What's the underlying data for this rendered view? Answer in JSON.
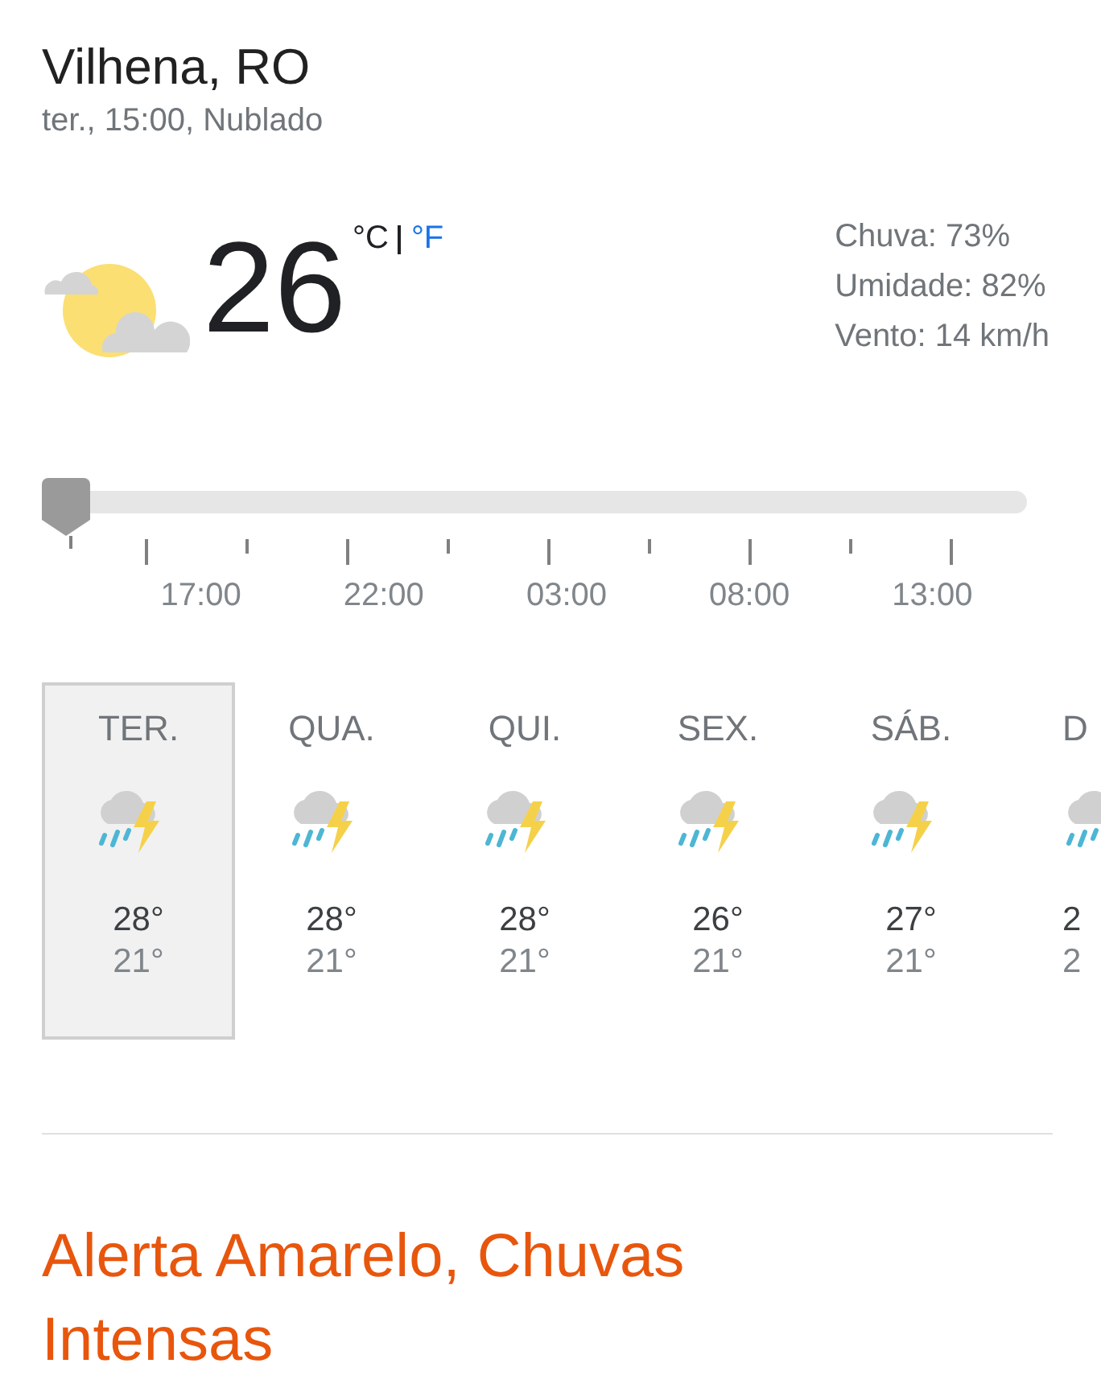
{
  "location": {
    "title": "Vilhena, RO",
    "subtitle": "ter., 15:00, Nublado"
  },
  "current": {
    "temperature": "26",
    "units": [
      {
        "label": "°C",
        "selected": true
      },
      {
        "label": "°F",
        "selected": false
      }
    ],
    "details": [
      "Chuva: 73%",
      "Umidade: 82%",
      "Vento: 14 km/h"
    ]
  },
  "timeline": {
    "level": 0,
    "labels": [
      "17:00",
      "22:00",
      "03:00",
      "08:00",
      "13:00"
    ]
  },
  "days": [
    {
      "day": "TER.",
      "high": "28°",
      "low": "21°",
      "selected": true
    },
    {
      "day": "QUA.",
      "high": "28°",
      "low": "21°",
      "selected": false
    },
    {
      "day": "QUI.",
      "high": "28°",
      "low": "21°",
      "selected": false
    },
    {
      "day": "SEX.",
      "high": "26°",
      "low": "21°",
      "selected": false
    },
    {
      "day": "SÁB.",
      "high": "27°",
      "low": "21°",
      "selected": false
    },
    {
      "day": "D",
      "high": "2",
      "low": "2",
      "selected": false
    }
  ],
  "alert": {
    "title": "Alerta Amarelo, Chuvas Intensas"
  }
}
